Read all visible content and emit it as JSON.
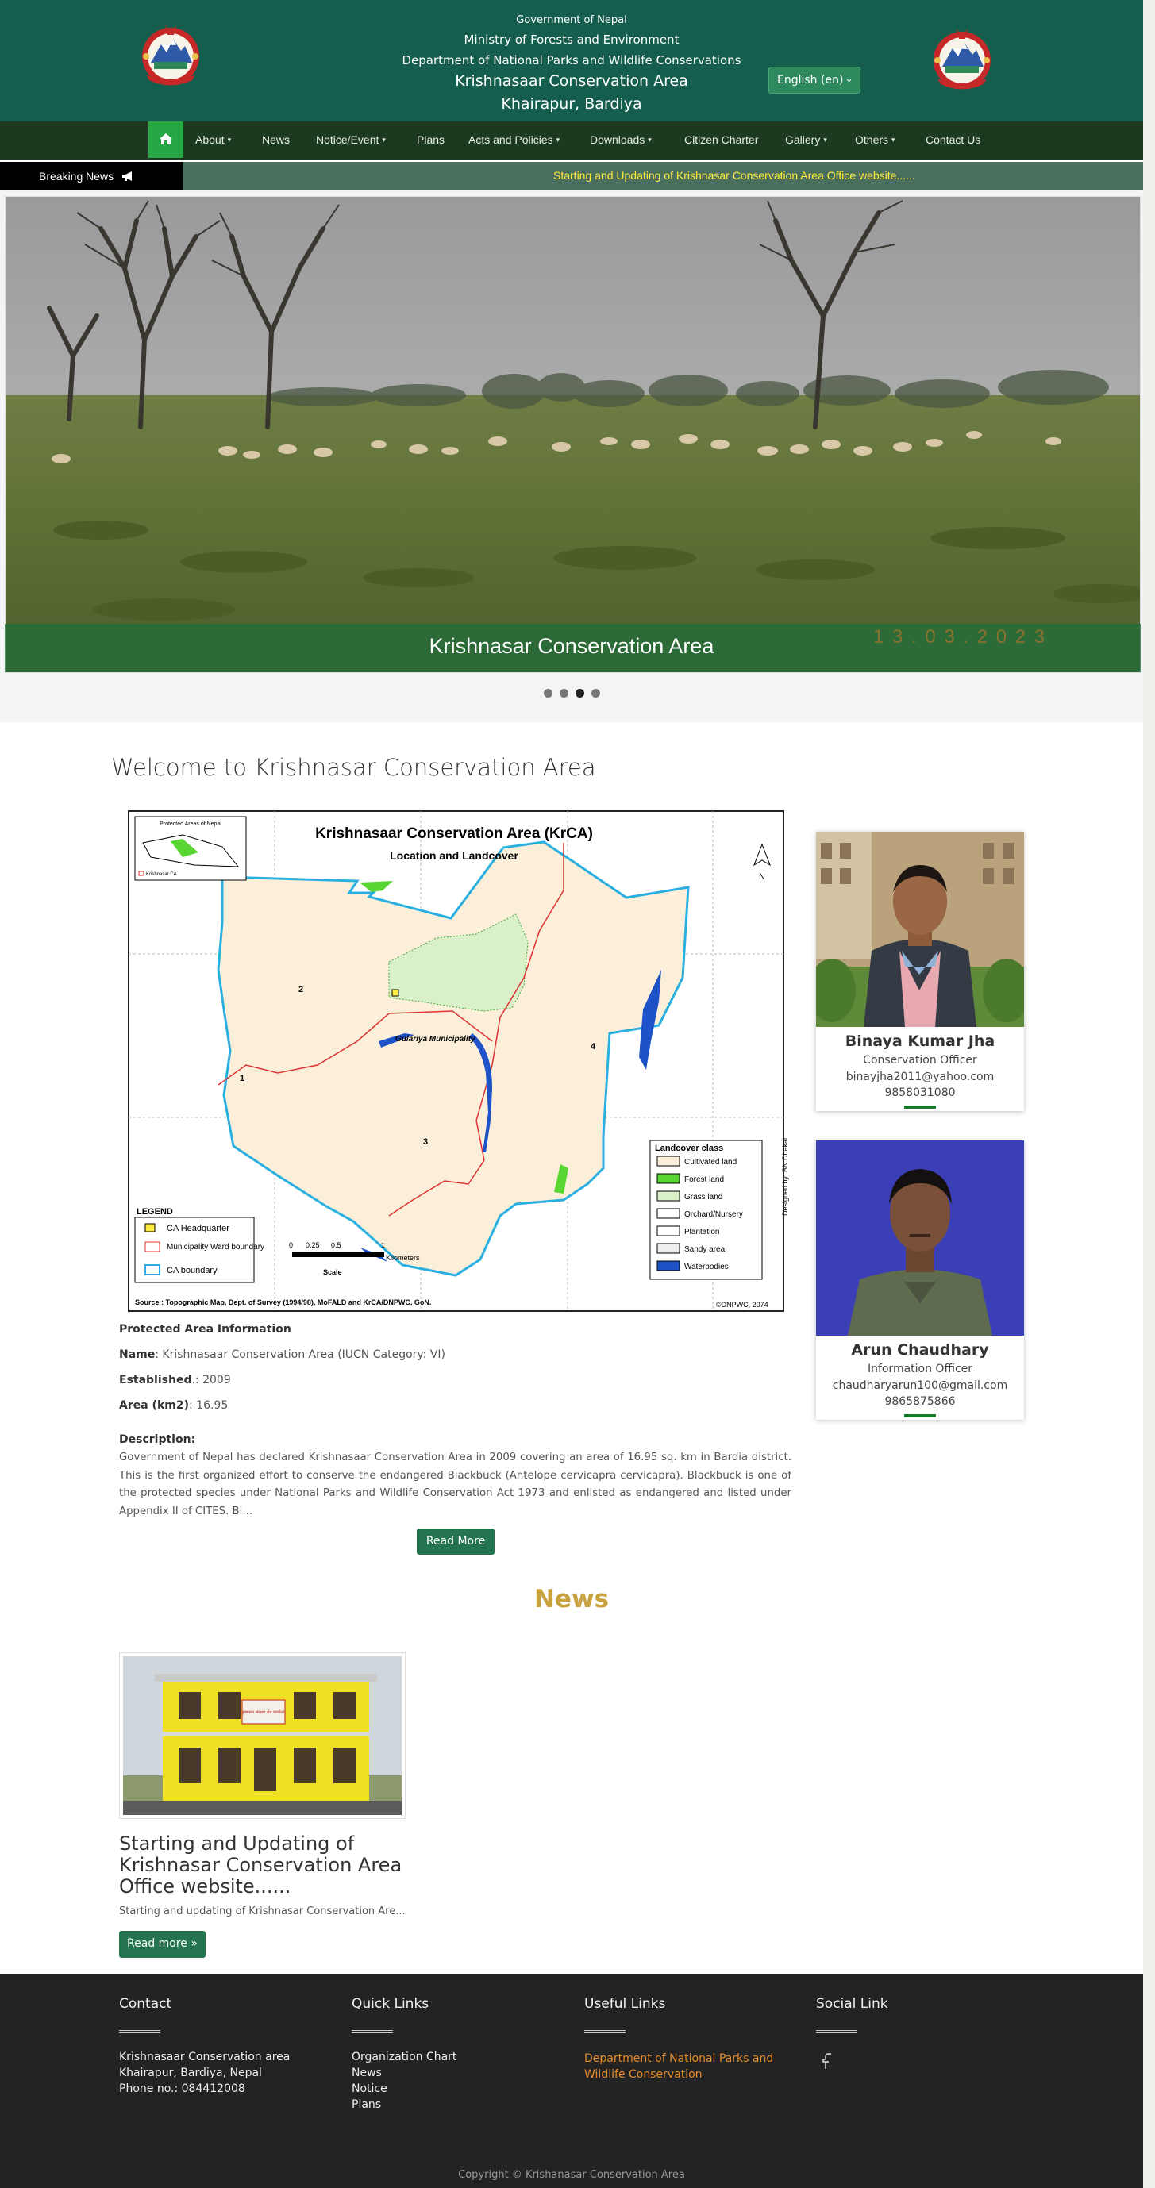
{
  "header": {
    "government": "Government of Nepal",
    "ministry": "Ministry of Forests and Environment",
    "department": "Department of National Parks and Wildlife Conservations",
    "ca_name": "Krishnasaar Conservation Area",
    "location": "Khairapur, Bardiya",
    "language": "English (en)"
  },
  "nav": {
    "items": [
      "About",
      "News",
      "Notice/Event",
      "Plans",
      "Acts and Policies",
      "Downloads",
      "Citizen Charter",
      "Gallery",
      "Others",
      "Contact Us"
    ]
  },
  "breaking": {
    "label": "Breaking News",
    "text": "Starting and Updating of Krishnasar Conservation Area Office website......"
  },
  "hero": {
    "caption": "Krishnasar Conservation Area",
    "stamp": "1 3 . 0 3 . 2 0 2 3"
  },
  "welcome": {
    "title": "Welcome to Krishnasar Conservation Area"
  },
  "map": {
    "title": "Krishnasaar Conservation Area (KrCA)",
    "subtitle": "Location and Landcover",
    "inset_title": "Protected Areas of Nepal",
    "inset_label": "Krishnasar CA",
    "municipality": "Gulariya Municipality",
    "wards": [
      "1",
      "2",
      "3",
      "4"
    ],
    "north": "N",
    "legend_title": "LEGEND",
    "legend_items": [
      "CA Headquarter",
      "Municipality Ward boundary",
      "CA boundary"
    ],
    "landcover_title": "Landcover class",
    "landcover_items": [
      "Cultivated land",
      "Forest land",
      "Grass land",
      "Orchard/Nursery",
      "Plantation",
      "Sandy area",
      "Waterbodies"
    ],
    "scale_ticks": [
      "0",
      "0.25",
      "0.5",
      "1"
    ],
    "scale_unit": "Kilometers",
    "scale_label": "Scale",
    "source": "Source : Topographic Map, Dept. of Survey (1994/98), MoFALD and KrCA/DNPWC, GoN.",
    "credit": "©DNPWC, 2074",
    "designer": "Designed by: BN Dhakal"
  },
  "protected_area": {
    "heading": "Protected Area Information",
    "name_label": "Name",
    "name_value": ": Krishnasaar Conservation Area (IUCN Category: VI)",
    "established_label": "Established",
    "established_value": ".: 2009",
    "area_label": "Area (km2)",
    "area_value": ": 16.95",
    "description_label": "Description",
    "description": "Government of Nepal has declared Krishnasaar Conservation Area in 2009 covering an area of 16.95 sq. km in Bardia district. This is the first organized effort to conserve the endangered Blackbuck (Antelope cervicapra cervicapra). Blackbuck is one of the protected species under National Parks and Wildlife Conservation Act 1973 and enlisted as endangered and listed under Appendix II of CITES.  Bl...",
    "read_more": "Read More"
  },
  "staff": [
    {
      "name": "Binaya Kumar Jha",
      "role": "Conservation Officer",
      "email": "binayjha2011@yahoo.com",
      "phone": "9858031080"
    },
    {
      "name": "Arun Chaudhary",
      "role": "Information Officer",
      "email": "chaudharyarun100@gmail.com",
      "phone": "9865875866"
    }
  ],
  "news": {
    "section_title": "News",
    "headline": "Starting and Updating of Krishnasar Conservation Area Office website......",
    "snippet": "Starting and updating of Krishnasar Conservation Are...",
    "read_more": "Read more »",
    "sign_text": "कृष्णसार संरक्षण क्षेत्र कार्यालय"
  },
  "footer": {
    "contact_title": "Contact",
    "contact_lines": [
      "Krishnasaar Conservation area",
      "Khairapur, Bardiya, Nepal",
      "Phone no.: 084412008"
    ],
    "quick_title": "Quick Links",
    "quick_links": [
      "Organization Chart",
      "News",
      "Notice",
      "Plans"
    ],
    "useful_title": "Useful Links",
    "useful_link": "Department of National Parks and Wildlife Conservation",
    "social_title": "Social Link",
    "copyright": "Copyright © Krishanasar Conservation Area"
  },
  "colors": {
    "header_bg": "#155d4d",
    "nav_bg": "#1b3a20",
    "home_button": "#28a745",
    "accent_button": "#24744f",
    "news_title": "#c8a23c",
    "breaking_text": "#ffeb3b",
    "footer_bg": "#232323",
    "useful_link": "#e58a2c"
  }
}
